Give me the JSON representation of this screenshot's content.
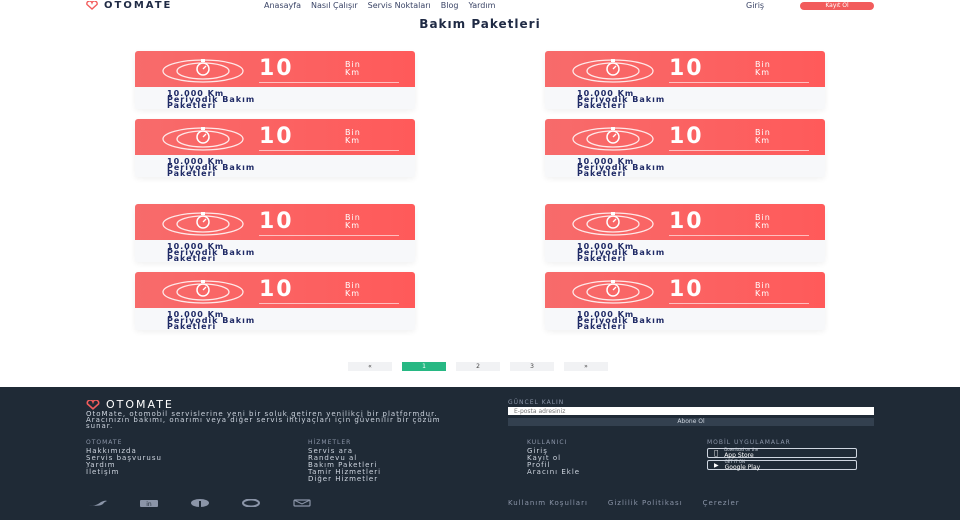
{
  "nav": {
    "brand": "OTOMATE",
    "links": [
      "Anasayfa",
      "Nasıl Çalışır",
      "Servis Noktaları",
      "Blog",
      "Yardım"
    ],
    "login": "Giriş",
    "signup": "Kayıt Ol"
  },
  "page_title": "Bakım Paketleri",
  "cards": [
    {
      "number": "10",
      "unit_top": "Bin",
      "unit_bottom": "Km",
      "title_line1": "10.000 Km",
      "title_line2": "Periyodik Bakım",
      "title_line3": "Paketleri"
    },
    {
      "number": "10",
      "unit_top": "Bin",
      "unit_bottom": "Km",
      "title_line1": "10.000 Km",
      "title_line2": "Periyodik Bakım",
      "title_line3": "Paketleri"
    },
    {
      "number": "10",
      "unit_top": "Bin",
      "unit_bottom": "Km",
      "title_line1": "10.000 Km",
      "title_line2": "Periyodik Bakım",
      "title_line3": "Paketleri"
    },
    {
      "number": "10",
      "unit_top": "Bin",
      "unit_bottom": "Km",
      "title_line1": "10.000 Km",
      "title_line2": "Periyodik Bakım",
      "title_line3": "Paketleri"
    },
    {
      "number": "10",
      "unit_top": "Bin",
      "unit_bottom": "Km",
      "title_line1": "10.000 Km",
      "title_line2": "Periyodik Bakım",
      "title_line3": "Paketleri"
    },
    {
      "number": "10",
      "unit_top": "Bin",
      "unit_bottom": "Km",
      "title_line1": "10.000 Km",
      "title_line2": "Periyodik Bakım",
      "title_line3": "Paketleri"
    },
    {
      "number": "10",
      "unit_top": "Bin",
      "unit_bottom": "Km",
      "title_line1": "10.000 Km",
      "title_line2": "Periyodik Bakım",
      "title_line3": "Paketleri"
    },
    {
      "number": "10",
      "unit_top": "Bin",
      "unit_bottom": "Km",
      "title_line1": "10.000 Km",
      "title_line2": "Periyodik Bakım",
      "title_line3": "Paketleri"
    }
  ],
  "pagination": {
    "prev": "«",
    "pages": [
      "1",
      "2",
      "3"
    ],
    "next": "»",
    "current": "1"
  },
  "footer": {
    "brand": "OTOMATE",
    "description": "OtoMate, otomobil servislerine yeni bir soluk getiren yenilikçi bir platformdur. Aracınızın bakımı, onarımı veya diğer servis ihtiyaçları için güvenilir bir çözüm sunar.",
    "col1": {
      "heading": "OTOMATE",
      "items": [
        "Hakkımızda",
        "Servis başvurusu",
        "Yardım",
        "İletişim"
      ]
    },
    "col2": {
      "heading": "HİZMETLER",
      "items": [
        "Servis ara",
        "Randevu al",
        "Bakım Paketleri",
        "Tamir Hizmetleri",
        "Diğer Hizmetler"
      ]
    },
    "col3": {
      "heading": "KULLANICI",
      "items": [
        "Giriş",
        "Kayıt ol",
        "Profil",
        "Aracını Ekle"
      ]
    },
    "col4": {
      "heading": "MOBİL UYGULAMALAR"
    },
    "newsletter": {
      "heading": "GÜNCEL KALIN",
      "placeholder": "E-posta adresiniz",
      "button": "Abone Ol"
    },
    "app_store": {
      "sub": "Download on the",
      "main": "App Store"
    },
    "google_play": {
      "sub": "GET IT ON",
      "main": "Google Play"
    },
    "legal": [
      "Kullanım Koşulları",
      "Gizlilik Politikası",
      "Çerezler"
    ],
    "socials": [
      "twitter-icon",
      "linkedin-icon",
      "facebook-icon",
      "github-icon",
      "mail-icon"
    ]
  },
  "colors": {
    "accent": "#f25c5c",
    "active_page": "#27b883",
    "footer_bg": "#1f2a36"
  }
}
